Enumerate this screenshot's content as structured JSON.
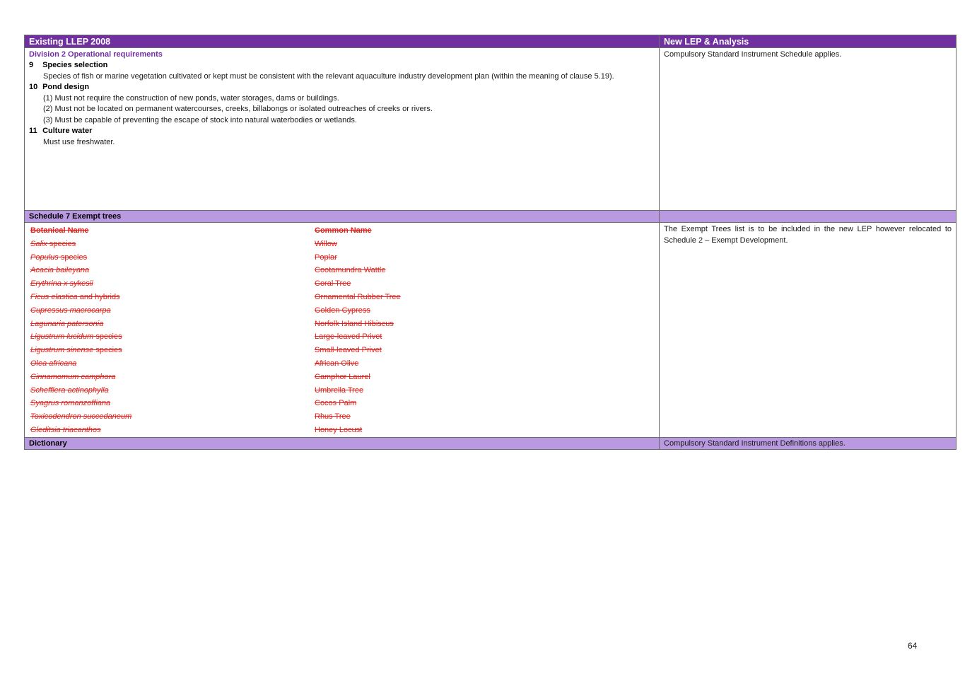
{
  "header": {
    "left": "Existing LLEP 2008",
    "right": "New LEP & Analysis"
  },
  "division": {
    "title": "Division 2 Operational requirements",
    "analysis": "Compulsory Standard Instrument Schedule applies.",
    "clauses": [
      {
        "num": "9",
        "title": "Species selection",
        "text": "Species of fish or marine vegetation cultivated or kept must be consistent with the relevant aquaculture industry development plan (within the meaning of clause 5.19)."
      },
      {
        "num": "10",
        "title": "Pond design",
        "items": [
          "(1)  Must not require the construction of new ponds, water storages, dams or buildings.",
          "(2)  Must not be located on permanent watercourses, creeks, billabongs or isolated outreaches of creeks or rivers.",
          "(3)  Must be capable of preventing the escape of stock into natural waterbodies or wetlands."
        ]
      },
      {
        "num": "11",
        "title": "Culture water",
        "text": "Must use freshwater."
      }
    ]
  },
  "schedule7": {
    "title": "Schedule 7 Exempt trees",
    "col_botanical": "Botanical Name",
    "col_common": "Common Name",
    "analysis": "The Exempt Trees list is to be included in the new LEP however relocated to Schedule 2 – Exempt Development.",
    "trees": [
      {
        "italic": "Salix",
        "rest": " species",
        "common": "Willow"
      },
      {
        "italic": "Populus",
        "rest": " species",
        "common": "Poplar"
      },
      {
        "italic": "Acacia baileyana",
        "rest": "",
        "common": "Cootamundra Wattle"
      },
      {
        "italic": "Erythrina x sykesii",
        "rest": "",
        "common": "Coral Tree"
      },
      {
        "italic": "Ficus elastica",
        "rest": " and hybrids",
        "common": "Ornamental Rubber Tree"
      },
      {
        "italic": "Cupressus macrocarpa",
        "rest": "",
        "common": "Golden Cypress"
      },
      {
        "italic": "Lagunaria patersonia",
        "rest": "",
        "common": "Norfolk Island Hibiscus"
      },
      {
        "italic": "Ligustrum lucidum",
        "rest": " species",
        "common": "Large-leaved Privet"
      },
      {
        "italic": "Ligustrum sinense",
        "rest": " species",
        "common": "Small-leaved Privet"
      },
      {
        "italic": "Olea africana",
        "rest": "",
        "common": "African Olive"
      },
      {
        "italic": "Cinnamomum camphora",
        "rest": "",
        "common": "Camphor Laurel"
      },
      {
        "italic": "Schefflera actinophylla",
        "rest": "",
        "common": "Umbrella Tree"
      },
      {
        "italic": "Syagrus romanzoffiana",
        "rest": "",
        "common": "Cocos Palm"
      },
      {
        "italic": "Toxicodendron succedaneum",
        "rest": "",
        "common": "Rhus Tree"
      },
      {
        "italic": "Gleditsia triacanthos",
        "rest": "",
        "common": "Honey Locust"
      }
    ]
  },
  "dictionary": {
    "title": "Dictionary",
    "analysis": "Compulsory Standard Instrument Definitions applies."
  },
  "colors": {
    "header_bg": "#7030a0",
    "section_bg": "#b99ae0",
    "deleted_text": "#e3201b"
  },
  "page_number": "64"
}
